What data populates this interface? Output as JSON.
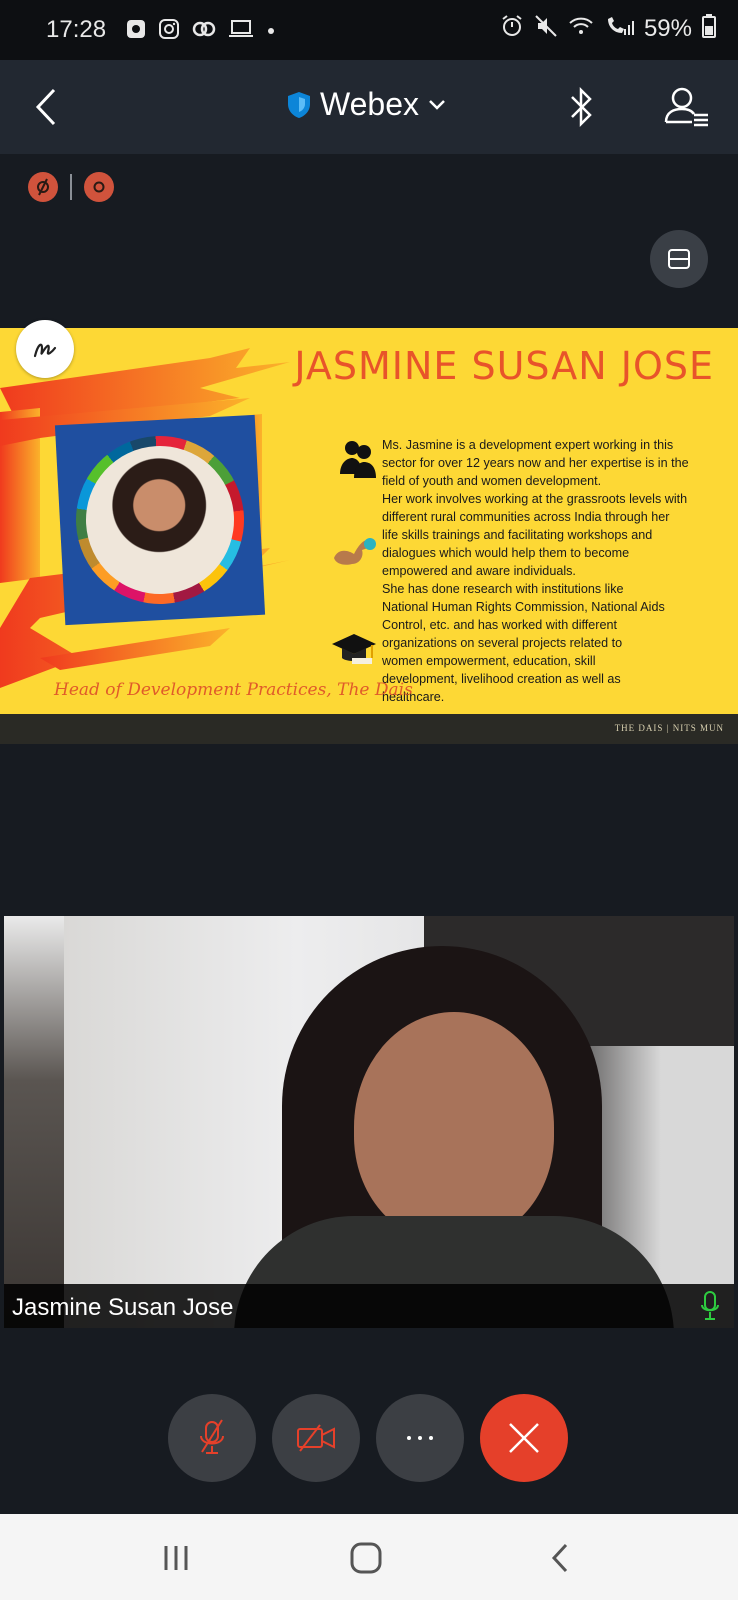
{
  "status_bar": {
    "time": "17:28",
    "battery_percent": "59%",
    "battery_level": 0.59
  },
  "header": {
    "title": "Webex"
  },
  "slide": {
    "title": "JASMINE SUSAN JOSE",
    "caption": "Head of Development Practices, The Dais",
    "bio_lines": [
      "Ms. Jasmine is a development expert working in this",
      "sector for over 12 years now and her expertise is in the",
      "field of youth and women development.",
      "Her work involves working at the grassroots levels with",
      "different rural communities across India through her",
      "life skills trainings and facilitating workshops and",
      "dialogues which would help them to become",
      "empowered and aware individuals.",
      "She has done research with institutions like",
      "National Human Rights Commission, National Aids",
      "Control, etc. and has worked with different",
      "organizations on several projects related to",
      "women empowerment, education, skill",
      "development, livelihood creation as well as",
      "healthcare."
    ],
    "footer": "THE DAIS | NITS MUN"
  },
  "video": {
    "participant_name": "Jasmine Susan Jose"
  },
  "colors": {
    "end_call": "#e5402a",
    "recording": "#d0533c",
    "slide_bg": "#fdd835",
    "slide_title": "#e8542a",
    "mic_active": "#2ecc40"
  },
  "icons": [
    "back-icon",
    "shield-icon",
    "chevron-down-icon",
    "bluetooth-icon",
    "participants-icon",
    "recording-paused-icon",
    "recording-icon",
    "layout-icon",
    "annotate-icon",
    "mic-icon",
    "mic-muted-icon",
    "video-off-icon",
    "more-icon",
    "end-call-icon",
    "recents-icon",
    "home-icon",
    "nav-back-icon"
  ]
}
